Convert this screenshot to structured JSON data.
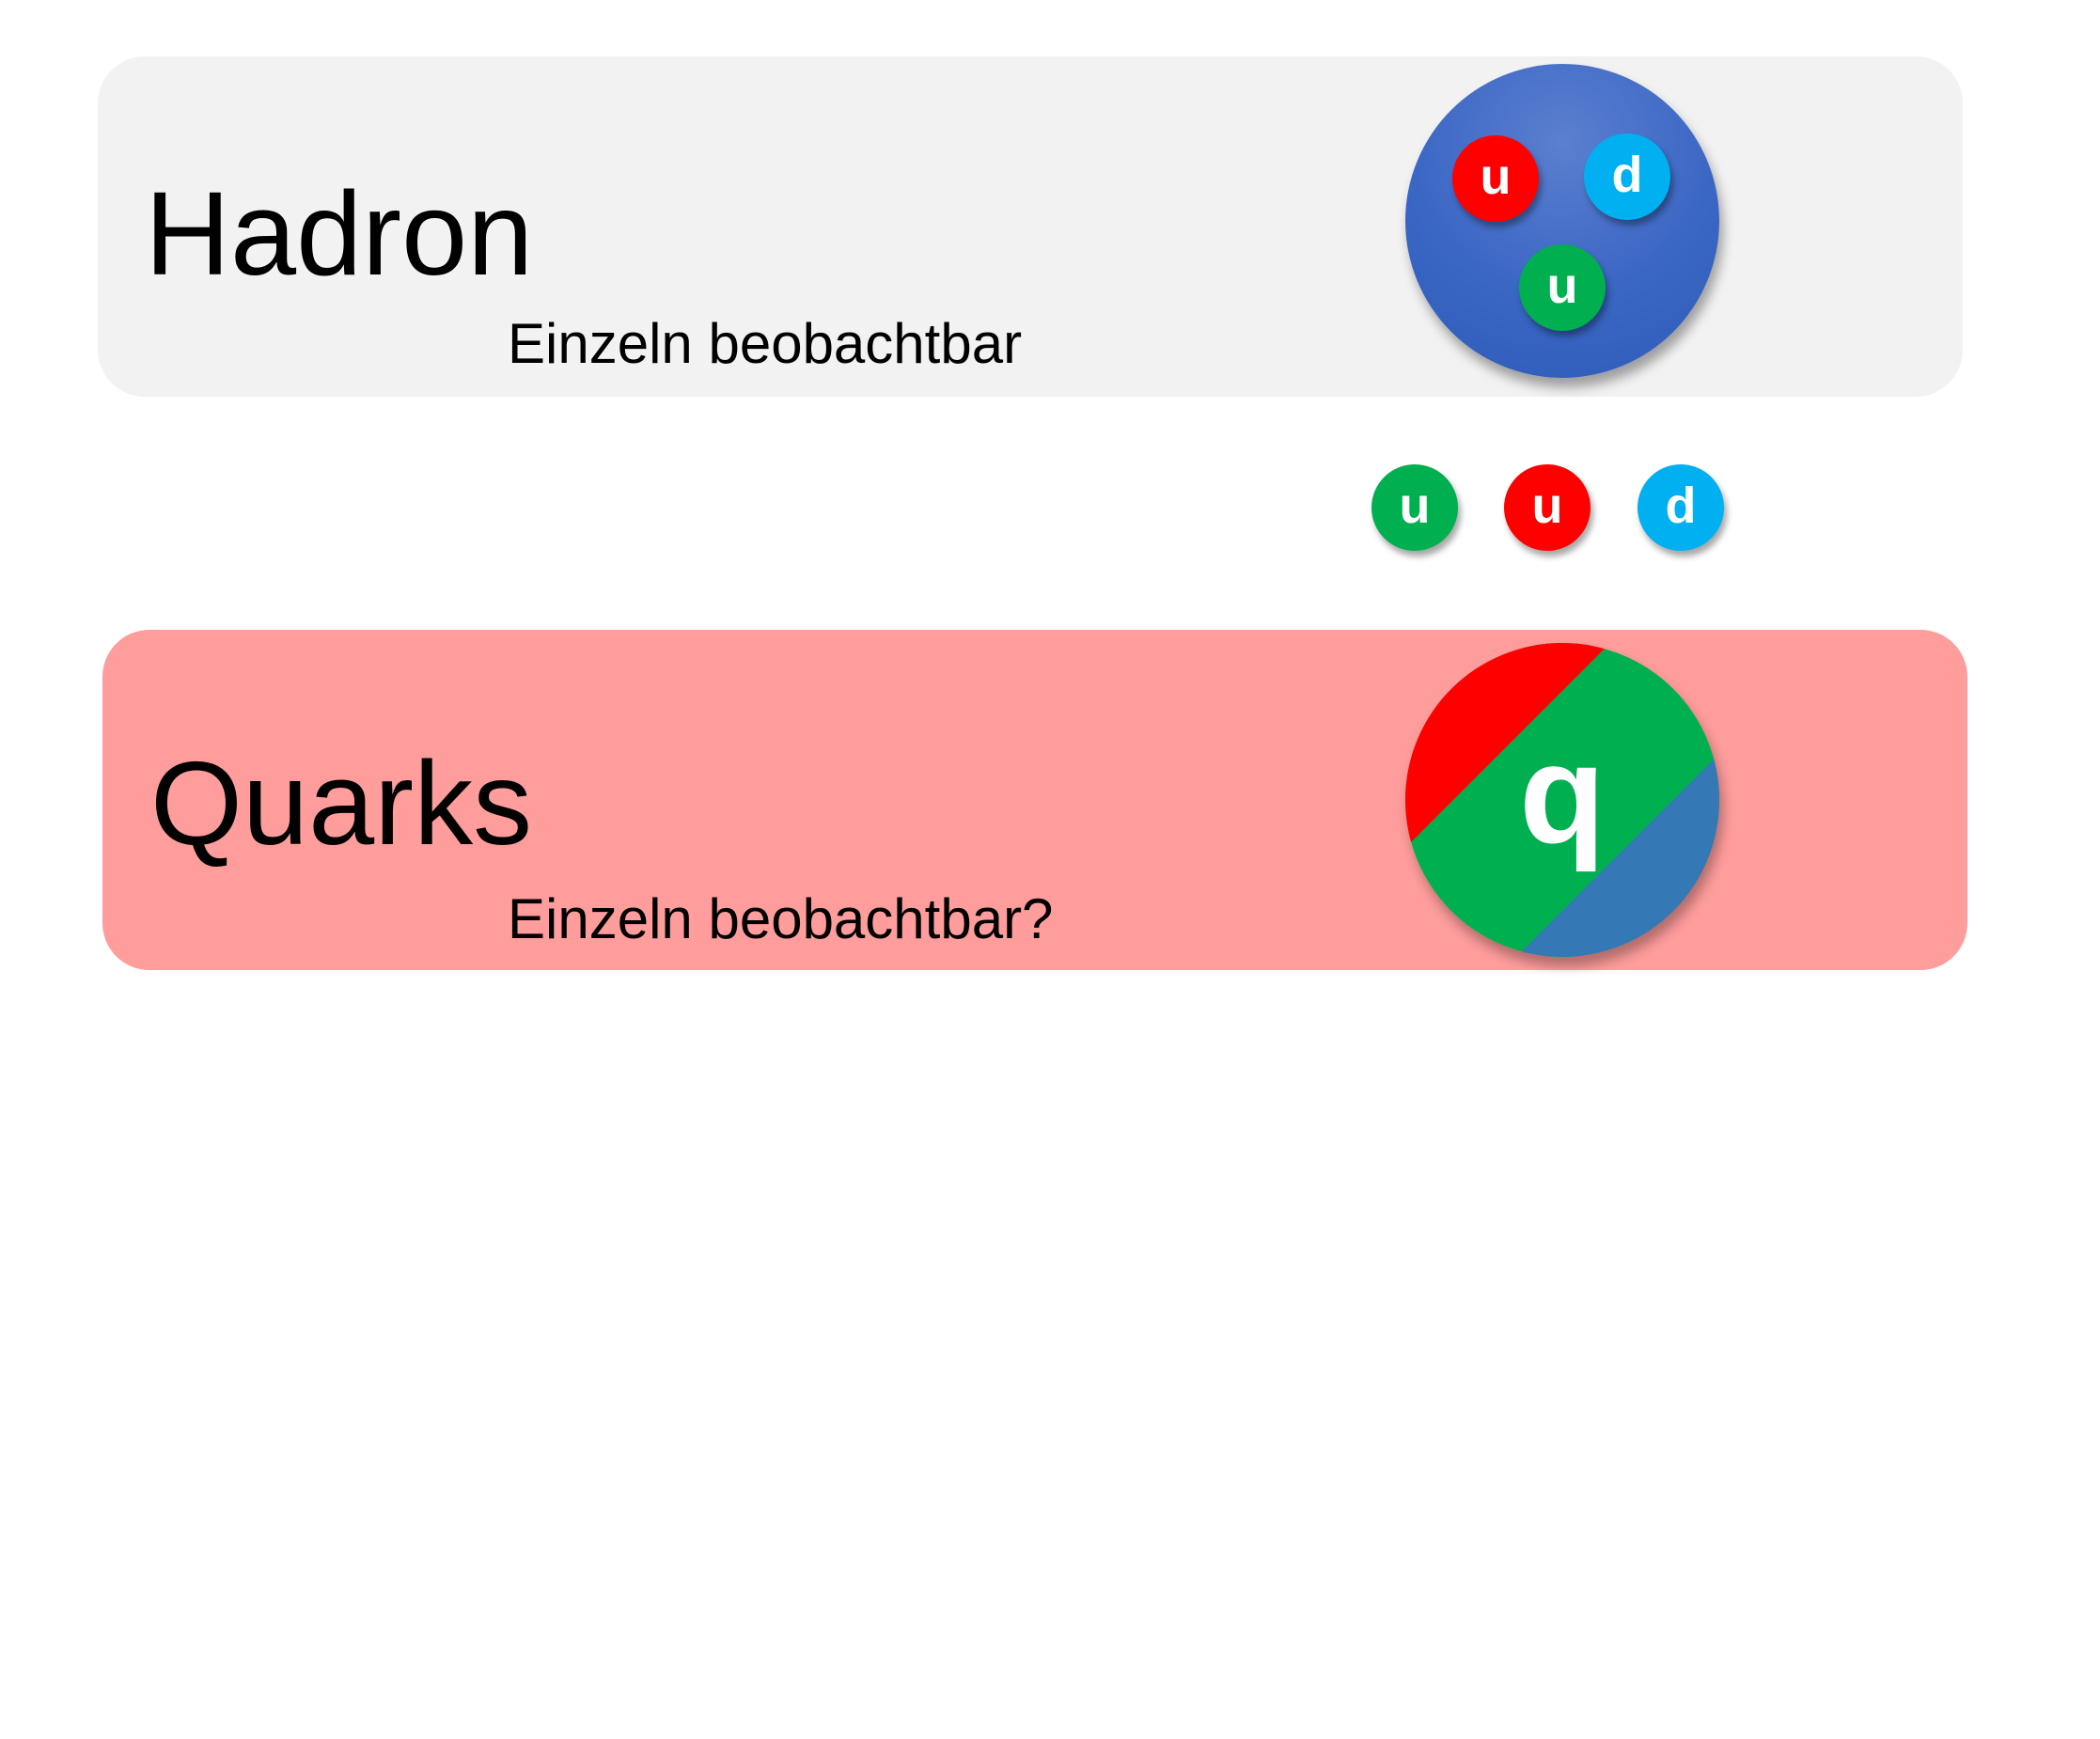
{
  "hadron": {
    "title": "Hadron",
    "subtitle": "Einzeln beobachtbar",
    "panel_color": "#f2f2f2",
    "ball_color": "#3a66c4",
    "quarks": [
      {
        "label": "u",
        "color": "#ff0000"
      },
      {
        "label": "d",
        "color": "#00b0f0"
      },
      {
        "label": "u",
        "color": "#00b050"
      }
    ]
  },
  "free_quarks": [
    {
      "label": "u",
      "color": "#00b050"
    },
    {
      "label": "u",
      "color": "#ff0000"
    },
    {
      "label": "d",
      "color": "#00b0f0"
    }
  ],
  "quarks": {
    "title": "Quarks",
    "subtitle": "Einzeln beobachtbar?",
    "panel_color": "#ff9c9c",
    "symbol": "q",
    "symbol_colors": [
      "#ff0000",
      "#00b050",
      "#3478b5"
    ]
  }
}
